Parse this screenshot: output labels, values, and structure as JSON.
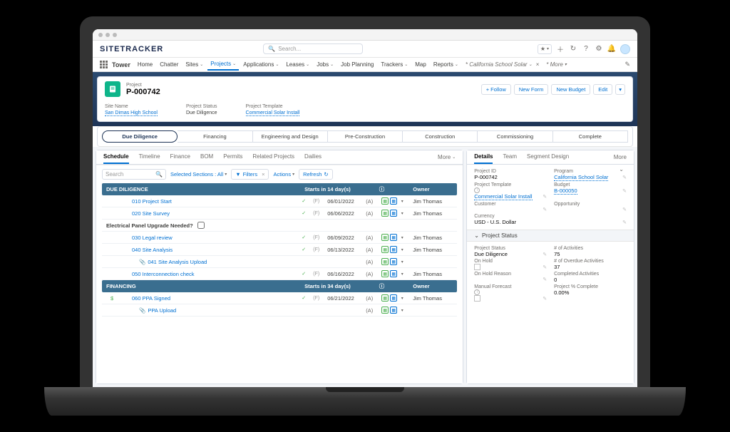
{
  "brand": "SITETRACKER",
  "search": {
    "placeholder": "Search..."
  },
  "nav": {
    "appLauncher": "Tower",
    "items": [
      "Home",
      "Chatter",
      "Sites",
      "Projects",
      "Applications",
      "Leases",
      "Jobs",
      "Job Planning",
      "Trackers",
      "Map",
      "Reports"
    ],
    "workspace": "* California School Solar",
    "more": "* More"
  },
  "record": {
    "type": "Project",
    "name": "P-000742",
    "actions": {
      "follow": "Follow",
      "newForm": "New Form",
      "newBudget": "New Budget",
      "edit": "Edit"
    },
    "fields": {
      "siteName": {
        "label": "Site Name",
        "value": "San Dimas High School"
      },
      "status": {
        "label": "Project Status",
        "value": "Due Diligence"
      },
      "template": {
        "label": "Project Template",
        "value": "Commercial Solar Install"
      }
    }
  },
  "stages": [
    "Due Diligence",
    "Financing",
    "Engineering and Design",
    "Pre-Construction",
    "Construction",
    "Commissioning",
    "Complete"
  ],
  "leftTabs": [
    "Schedule",
    "Timeline",
    "Finance",
    "BOM",
    "Permits",
    "Related Projects",
    "Dailies"
  ],
  "leftMore": "More",
  "toolbar": {
    "searchPlaceholder": "Search",
    "sections": "Selected Sections : All",
    "filters": "Filters",
    "actions": "Actions",
    "refresh": "Refresh"
  },
  "schedule": {
    "sections": [
      {
        "title": "DUE DILIGENCE",
        "starts": "Starts in 14 day(s)",
        "ownerHead": "Owner",
        "rows": [
          {
            "name": "010 Project Start",
            "f": "(F)",
            "date": "06/01/2022",
            "a": "(A)",
            "owner": "Jim Thomas",
            "check": true
          },
          {
            "name": "020 Site Survey",
            "f": "(F)",
            "date": "06/06/2022",
            "a": "(A)",
            "owner": "Jim Thomas",
            "check": true
          }
        ],
        "question": "Electrical Panel Upgrade Needed?",
        "rows2": [
          {
            "name": "030 Legal review",
            "f": "(F)",
            "date": "06/09/2022",
            "a": "(A)",
            "owner": "Jim Thomas",
            "check": true
          },
          {
            "name": "040 Site Analysis",
            "f": "(F)",
            "date": "06/13/2022",
            "a": "(A)",
            "owner": "Jim Thomas",
            "check": true
          },
          {
            "name": "041 Site Analysis Upload",
            "f": "",
            "date": "",
            "a": "(A)",
            "owner": "",
            "check": false,
            "attach": true,
            "indent": true
          },
          {
            "name": "050 Interconnection check",
            "f": "(F)",
            "date": "06/16/2022",
            "a": "(A)",
            "owner": "Jim Thomas",
            "check": true
          }
        ]
      },
      {
        "title": "FINANCING",
        "starts": "Starts in 34 day(s)",
        "ownerHead": "Owner",
        "rows": [
          {
            "name": "060 PPA Signed",
            "f": "(F)",
            "date": "06/21/2022",
            "a": "(A)",
            "owner": "Jim Thomas",
            "check": true,
            "dollar": true
          },
          {
            "name": "PPA Upload",
            "f": "",
            "date": "",
            "a": "(A)",
            "owner": "",
            "check": false,
            "attach": true,
            "indent": true
          }
        ]
      }
    ]
  },
  "rightTabs": [
    "Details",
    "Team",
    "Segment Design"
  ],
  "rightMore": "More",
  "details": {
    "projectId": {
      "label": "Project ID",
      "value": "P-000742"
    },
    "program": {
      "label": "Program",
      "value": "California School Solar"
    },
    "template": {
      "label": "Project Template",
      "value": "Commercial Solar Install"
    },
    "budget": {
      "label": "Budget",
      "value": "B-000050"
    },
    "customer": {
      "label": "Customer",
      "value": ""
    },
    "opportunity": {
      "label": "Opportunity",
      "value": ""
    },
    "currency": {
      "label": "Currency",
      "value": "USD - U.S. Dollar"
    },
    "statusSection": "Project Status",
    "projectStatus": {
      "label": "Project Status",
      "value": "Due Diligence"
    },
    "numActivities": {
      "label": "# of Activities",
      "value": "75"
    },
    "onHold": {
      "label": "On Hold",
      "value": ""
    },
    "overdueActivities": {
      "label": "# of Overdue Activities",
      "value": "37"
    },
    "onHoldReason": {
      "label": "On Hold Reason",
      "value": ""
    },
    "completedActivities": {
      "label": "Completed Activities",
      "value": "0"
    },
    "manualForecast": {
      "label": "Manual Forecast",
      "value": ""
    },
    "pctComplete": {
      "label": "Project % Complete",
      "value": "0.00%"
    }
  }
}
